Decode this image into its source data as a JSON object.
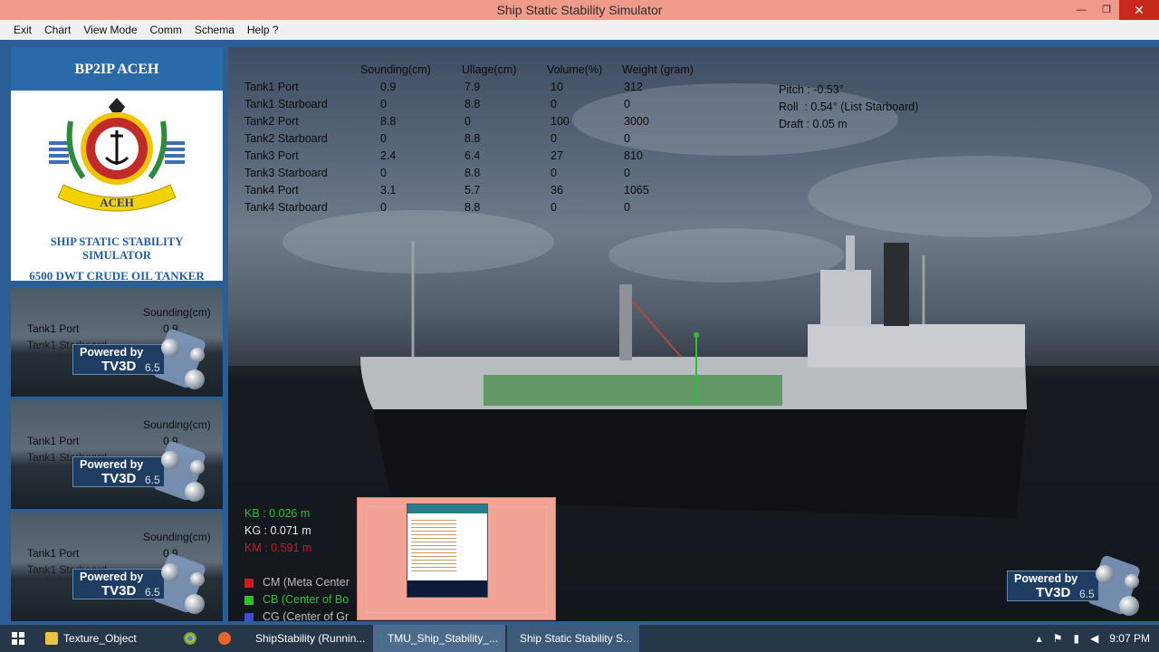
{
  "window": {
    "title": "Ship Static Stability Simulator",
    "minimize": "—",
    "restore": "❐",
    "close": "✕"
  },
  "menu": [
    "Exit",
    "Chart",
    "View Mode",
    "Comm",
    "Schema",
    "Help ?"
  ],
  "logo_panel": {
    "header": "BP2IP ACEH",
    "emblem_text": "ACEH",
    "line1": "SHIP STATIC STABILITY",
    "line2": "SIMULATOR",
    "line3": "6500 DWT CRUDE OIL TANKER"
  },
  "thumbnails": [
    {
      "header": "Sounding(cm)",
      "row1_label": "Tank1 Port",
      "row1_value": "0.9",
      "row2_label": "Tank1 Starboard"
    },
    {
      "header": "Sounding(cm)",
      "row1_label": "Tank1 Port",
      "row1_value": "0.9",
      "row2_label": "Tank1 Starboard"
    },
    {
      "header": "Sounding(cm)",
      "row1_label": "Tank1 Port",
      "row1_value": "0.9",
      "row2_label": "Tank1 Starboard"
    }
  ],
  "badge": {
    "powered": "Powered by",
    "product": "TV3D",
    "version": "6.5"
  },
  "tank_table": {
    "headers": [
      "Sounding(cm)",
      "Ullage(cm)",
      "Volume(%)",
      "Weight (gram)"
    ],
    "rows": [
      {
        "name": "Tank1 Port",
        "sounding": "0.9",
        "ullage": "7.9",
        "volume": "10",
        "weight": "312"
      },
      {
        "name": "Tank1 Starboard",
        "sounding": "0",
        "ullage": "8.8",
        "volume": "0",
        "weight": "0"
      },
      {
        "name": "Tank2 Port",
        "sounding": "8.8",
        "ullage": "0",
        "volume": "100",
        "weight": "3000"
      },
      {
        "name": "Tank2 Starboard",
        "sounding": "0",
        "ullage": "8.8",
        "volume": "0",
        "weight": "0"
      },
      {
        "name": "Tank3 Port",
        "sounding": "2.4",
        "ullage": "6.4",
        "volume": "27",
        "weight": "810"
      },
      {
        "name": "Tank3 Starboard",
        "sounding": "0",
        "ullage": "8.8",
        "volume": "0",
        "weight": "0"
      },
      {
        "name": "Tank4 Port",
        "sounding": "3.1",
        "ullage": "5.7",
        "volume": "36",
        "weight": "1065"
      },
      {
        "name": "Tank4 Starboard",
        "sounding": "0",
        "ullage": "8.8",
        "volume": "0",
        "weight": "0"
      }
    ]
  },
  "stability": {
    "pitch": "Pitch : -0.53°",
    "roll": "Roll  : 0.54° (List Starboard)",
    "draft": "Draft : 0.05 m"
  },
  "metrics": {
    "kb": "KB : 0.026 m",
    "kg": "KG : 0.071 m",
    "km": "KM : 0.591 m"
  },
  "legend": {
    "cm": "CM (Meta Center",
    "cb": "CB (Center of Bo",
    "cg": "CG (Center of Gr"
  },
  "colors": {
    "kb": "#2fbf2f",
    "kg": "#e6e6e6",
    "km": "#c81e1e",
    "cm": "#c81e1e",
    "cb": "#2fbf2f",
    "cg": "#3a4cd0"
  },
  "taskbar": {
    "tasks": [
      "Texture_Object",
      "ShipStability (Runnin...",
      "TMU_Ship_Stability_...",
      "Ship Static Stability S..."
    ],
    "time": "9:07 PM"
  }
}
